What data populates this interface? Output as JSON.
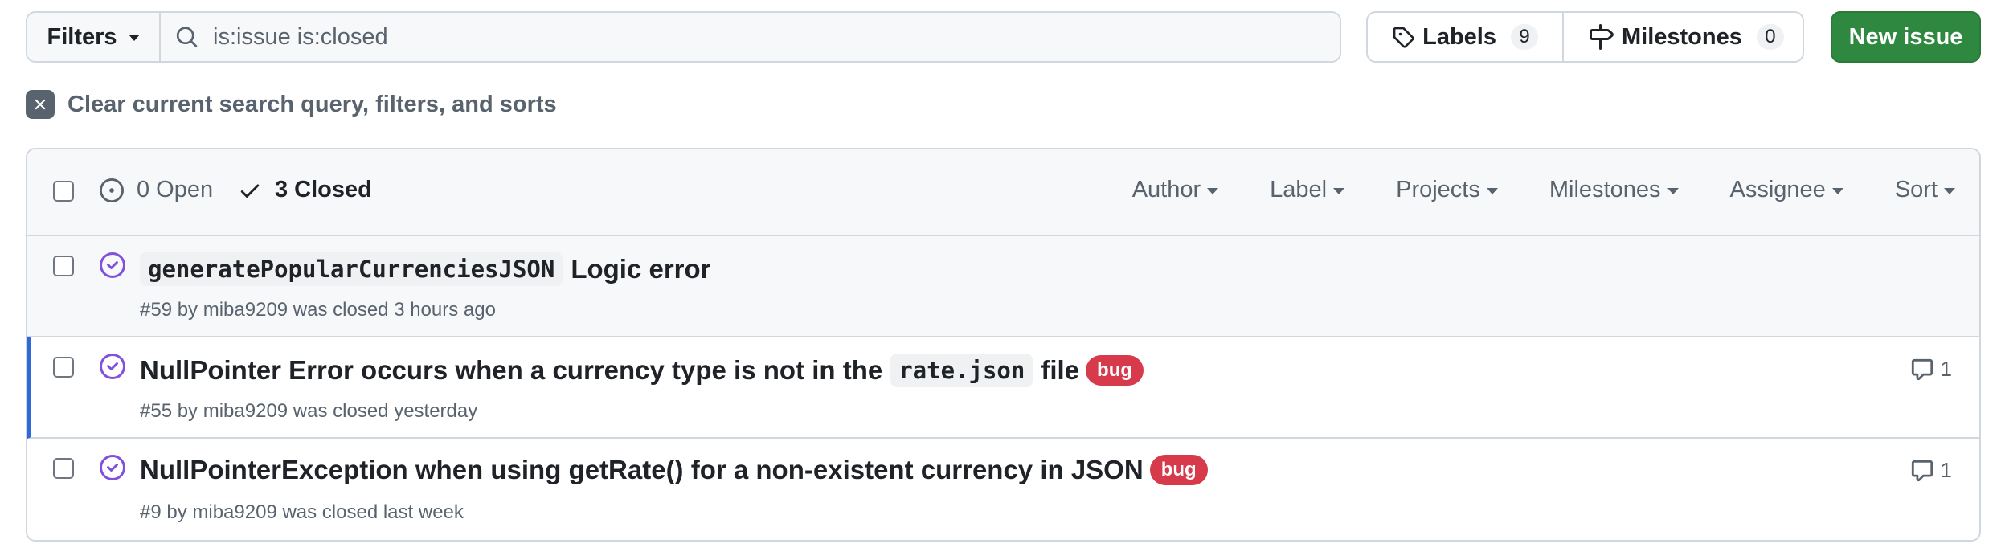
{
  "toolbar": {
    "filters_label": "Filters",
    "search_value": "is:issue is:closed",
    "labels_label": "Labels",
    "labels_count": "9",
    "milestones_label": "Milestones",
    "milestones_count": "0",
    "new_issue_label": "New issue"
  },
  "clear_query": {
    "label": "Clear current search query, filters, and sorts"
  },
  "issues_header": {
    "open_label": "0 Open",
    "closed_label": "3 Closed",
    "filters": [
      "Author",
      "Label",
      "Projects",
      "Milestones",
      "Assignee",
      "Sort"
    ]
  },
  "issues": [
    {
      "title_code": "generatePopularCurrenciesJSON",
      "title_text": "Logic error",
      "meta": "#59 by miba9209 was closed 3 hours ago",
      "labels": [],
      "comments": ""
    },
    {
      "title_before": "NullPointer Error occurs when a currency type is not in the",
      "title_code": "rate.json",
      "title_after": "file",
      "meta": "#55 by miba9209 was closed yesterday",
      "label": "bug",
      "comments": "1"
    },
    {
      "title_text": "NullPointerException when using getRate() for a non-existent currency in JSON",
      "meta": "#9 by miba9209 was closed last week",
      "label": "bug",
      "comments": "1"
    }
  ],
  "colors": {
    "accent_green": "#2f883f",
    "closed_purple": "#8250df",
    "bug_red": "#d73a4a",
    "active_blue": "#2f69d9"
  },
  "icons": [
    "search-icon",
    "tag-icon",
    "milestone-icon",
    "x-icon",
    "issue-open-icon",
    "check-icon",
    "issue-closed-icon",
    "comment-icon",
    "caret-down-icon"
  ]
}
